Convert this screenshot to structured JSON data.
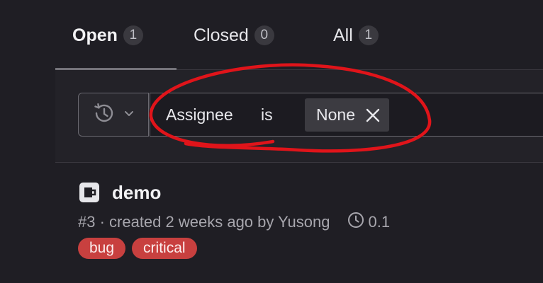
{
  "tabs": [
    {
      "label": "Open",
      "count": "1",
      "active": true
    },
    {
      "label": "Closed",
      "count": "0",
      "active": false
    },
    {
      "label": "All",
      "count": "1",
      "active": false
    }
  ],
  "filter": {
    "history_icon": "history-clock-icon",
    "tokens": {
      "field": "Assignee",
      "operator": "is",
      "value": "None"
    }
  },
  "issue": {
    "title": "demo",
    "meta": "#3 · created 2 weeks ago by Yusong",
    "milestone": "0.1",
    "labels": [
      "bug",
      "critical"
    ]
  },
  "colors": {
    "background": "#1f1e24",
    "label_red": "#c8403f",
    "annotation_red": "#e0141a"
  }
}
